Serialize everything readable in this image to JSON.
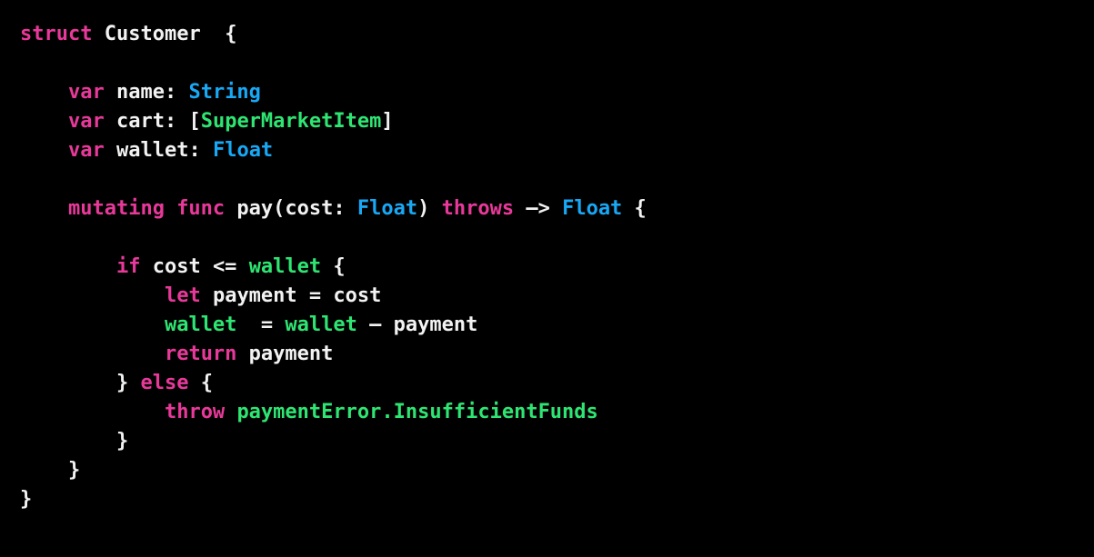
{
  "editor": {
    "name": "swift-code-snippet",
    "language": "Swift",
    "background_color": "#000000",
    "font_size_px": 22,
    "line_height_px": 32,
    "colors": {
      "background": "#000000",
      "plain": "#f2f2f2",
      "keyword": "#e8399a",
      "type": "#18a8f5",
      "identifier": "#2ee573"
    }
  },
  "code": {
    "lines": [
      {
        "index": 0,
        "text": "struct Customer  {",
        "tokens": [
          {
            "t": "struct",
            "k": "keyword"
          },
          {
            "t": " ",
            "k": "plain"
          },
          {
            "t": "Customer",
            "k": "plain"
          },
          {
            "t": "  ",
            "k": "plain"
          },
          {
            "t": "{",
            "k": "punct"
          }
        ]
      },
      {
        "index": 1,
        "text": "",
        "tokens": []
      },
      {
        "index": 2,
        "text": "    var name: String",
        "tokens": [
          {
            "t": "    ",
            "k": "plain"
          },
          {
            "t": "var",
            "k": "keyword"
          },
          {
            "t": " name: ",
            "k": "plain"
          },
          {
            "t": "String",
            "k": "type"
          }
        ]
      },
      {
        "index": 3,
        "text": "    var cart: [SuperMarketItem]",
        "tokens": [
          {
            "t": "    ",
            "k": "plain"
          },
          {
            "t": "var",
            "k": "keyword"
          },
          {
            "t": " cart: [",
            "k": "plain"
          },
          {
            "t": "SuperMarketItem",
            "k": "identifier"
          },
          {
            "t": "]",
            "k": "punct"
          }
        ]
      },
      {
        "index": 4,
        "text": "    var wallet: Float",
        "tokens": [
          {
            "t": "    ",
            "k": "plain"
          },
          {
            "t": "var",
            "k": "keyword"
          },
          {
            "t": " wallet: ",
            "k": "plain"
          },
          {
            "t": "Float",
            "k": "type"
          }
        ]
      },
      {
        "index": 5,
        "text": "",
        "tokens": []
      },
      {
        "index": 6,
        "text": "    mutating func pay(cost: Float) throws –> Float {",
        "tokens": [
          {
            "t": "    ",
            "k": "plain"
          },
          {
            "t": "mutating func",
            "k": "keyword"
          },
          {
            "t": " pay(cost: ",
            "k": "plain"
          },
          {
            "t": "Float",
            "k": "type"
          },
          {
            "t": ") ",
            "k": "plain"
          },
          {
            "t": "throws",
            "k": "keyword"
          },
          {
            "t": " –> ",
            "k": "plain"
          },
          {
            "t": "Float",
            "k": "type"
          },
          {
            "t": " {",
            "k": "punct"
          }
        ]
      },
      {
        "index": 7,
        "text": "",
        "tokens": []
      },
      {
        "index": 8,
        "text": "        if cost <= wallet {",
        "tokens": [
          {
            "t": "        ",
            "k": "plain"
          },
          {
            "t": "if",
            "k": "keyword"
          },
          {
            "t": " cost <= ",
            "k": "plain"
          },
          {
            "t": "wallet",
            "k": "identifier"
          },
          {
            "t": " {",
            "k": "punct"
          }
        ]
      },
      {
        "index": 9,
        "text": "            let payment = cost",
        "tokens": [
          {
            "t": "            ",
            "k": "plain"
          },
          {
            "t": "let",
            "k": "keyword"
          },
          {
            "t": " payment = cost",
            "k": "plain"
          }
        ]
      },
      {
        "index": 10,
        "text": "            wallet  = wallet – payment",
        "tokens": [
          {
            "t": "            ",
            "k": "plain"
          },
          {
            "t": "wallet",
            "k": "identifier"
          },
          {
            "t": "  = ",
            "k": "plain"
          },
          {
            "t": "wallet",
            "k": "identifier"
          },
          {
            "t": " – payment",
            "k": "plain"
          }
        ]
      },
      {
        "index": 11,
        "text": "            return payment",
        "tokens": [
          {
            "t": "            ",
            "k": "plain"
          },
          {
            "t": "return",
            "k": "keyword"
          },
          {
            "t": " payment",
            "k": "plain"
          }
        ]
      },
      {
        "index": 12,
        "text": "        } else {",
        "tokens": [
          {
            "t": "        ",
            "k": "plain"
          },
          {
            "t": "}",
            "k": "punct"
          },
          {
            "t": " ",
            "k": "plain"
          },
          {
            "t": "else",
            "k": "keyword"
          },
          {
            "t": " {",
            "k": "punct"
          }
        ]
      },
      {
        "index": 13,
        "text": "            throw paymentError.InsufficientFunds",
        "tokens": [
          {
            "t": "            ",
            "k": "plain"
          },
          {
            "t": "throw",
            "k": "keyword"
          },
          {
            "t": " ",
            "k": "plain"
          },
          {
            "t": "paymentError.InsufficientFunds",
            "k": "identifier"
          }
        ]
      },
      {
        "index": 14,
        "text": "        }",
        "tokens": [
          {
            "t": "        ",
            "k": "plain"
          },
          {
            "t": "}",
            "k": "punct"
          }
        ]
      },
      {
        "index": 15,
        "text": "    }",
        "tokens": [
          {
            "t": "    ",
            "k": "plain"
          },
          {
            "t": "}",
            "k": "punct"
          }
        ]
      },
      {
        "index": 16,
        "text": "}",
        "tokens": [
          {
            "t": "}",
            "k": "punct"
          }
        ]
      }
    ]
  }
}
